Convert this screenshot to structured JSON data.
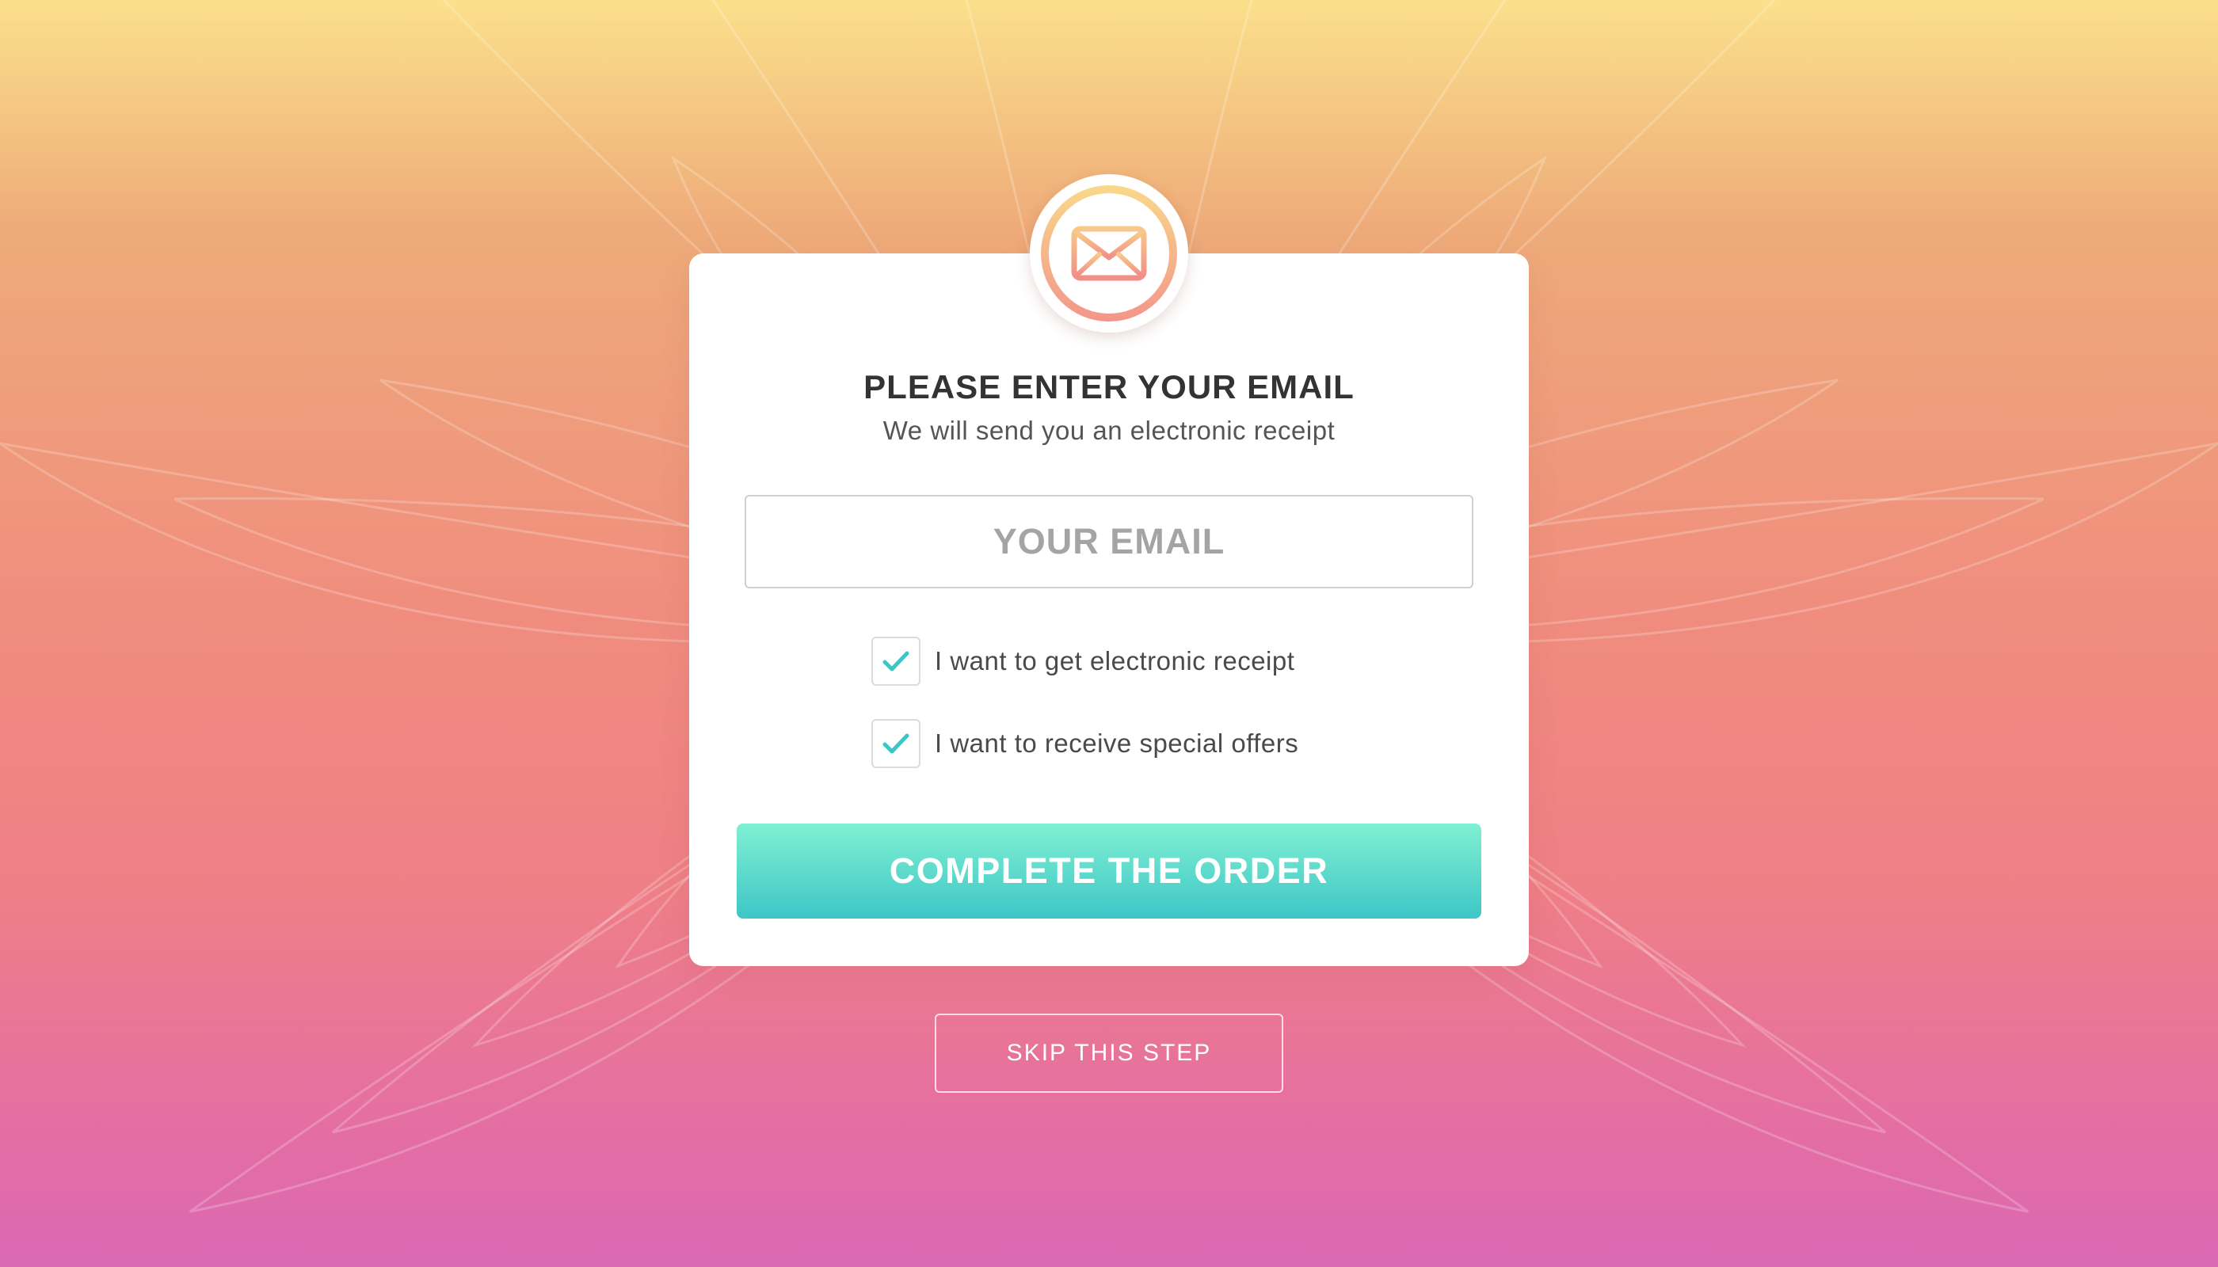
{
  "colors": {
    "background_top": "#fbe08b",
    "background_bottom": "#da68b4",
    "accent": "#3ec6c6",
    "accent_light": "#80f0d2",
    "check": "#3ec6c6",
    "icon_gradient_top": "#f9d98a",
    "icon_gradient_bottom": "#f3958a"
  },
  "badge": {
    "icon": "envelope-icon"
  },
  "form": {
    "title": "PLEASE ENTER YOUR EMAIL",
    "subtitle": "We will send you an electronic receipt",
    "email_placeholder": "YOUR EMAIL",
    "email_value": "",
    "options": [
      {
        "label": "I want to get electronic receipt",
        "checked": true,
        "icon": "checkmark-icon"
      },
      {
        "label": "I want to receive special offers",
        "checked": true,
        "icon": "checkmark-icon"
      }
    ],
    "submit_label": "COMPLETE THE ORDER"
  },
  "skip_label": "SKIP THIS STEP"
}
